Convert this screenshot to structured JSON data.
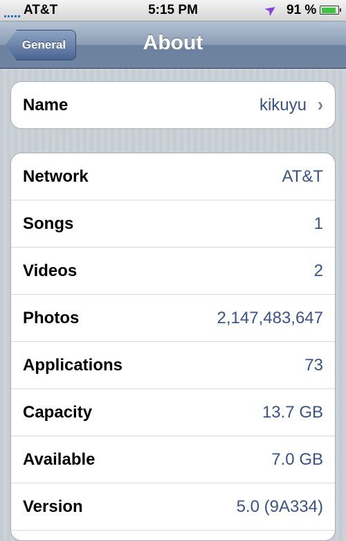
{
  "status_bar": {
    "carrier": "AT&T",
    "time": "5:15 PM",
    "battery_percent": "91 %",
    "battery_level": 0.91,
    "location_icon": "location-arrow-icon",
    "signal_icon": "signal-bars-icon",
    "battery_icon": "battery-icon"
  },
  "nav": {
    "back_label": "General",
    "title": "About"
  },
  "name_row": {
    "label": "Name",
    "value": "kikuyu",
    "chevron": "›"
  },
  "info_rows": [
    {
      "label": "Network",
      "value": "AT&T"
    },
    {
      "label": "Songs",
      "value": "1"
    },
    {
      "label": "Videos",
      "value": "2"
    },
    {
      "label": "Photos",
      "value": "2,147,483,647"
    },
    {
      "label": "Applications",
      "value": "73"
    },
    {
      "label": "Capacity",
      "value": "13.7 GB"
    },
    {
      "label": "Available",
      "value": "7.0 GB"
    },
    {
      "label": "Version",
      "value": "5.0 (9A334)"
    }
  ],
  "colors": {
    "value_text": "#385487",
    "nav_bar": "#6e84a2",
    "background": "#c5ccd4",
    "battery_fill": "#3cc43c",
    "location_icon": "#8b3fd9"
  }
}
